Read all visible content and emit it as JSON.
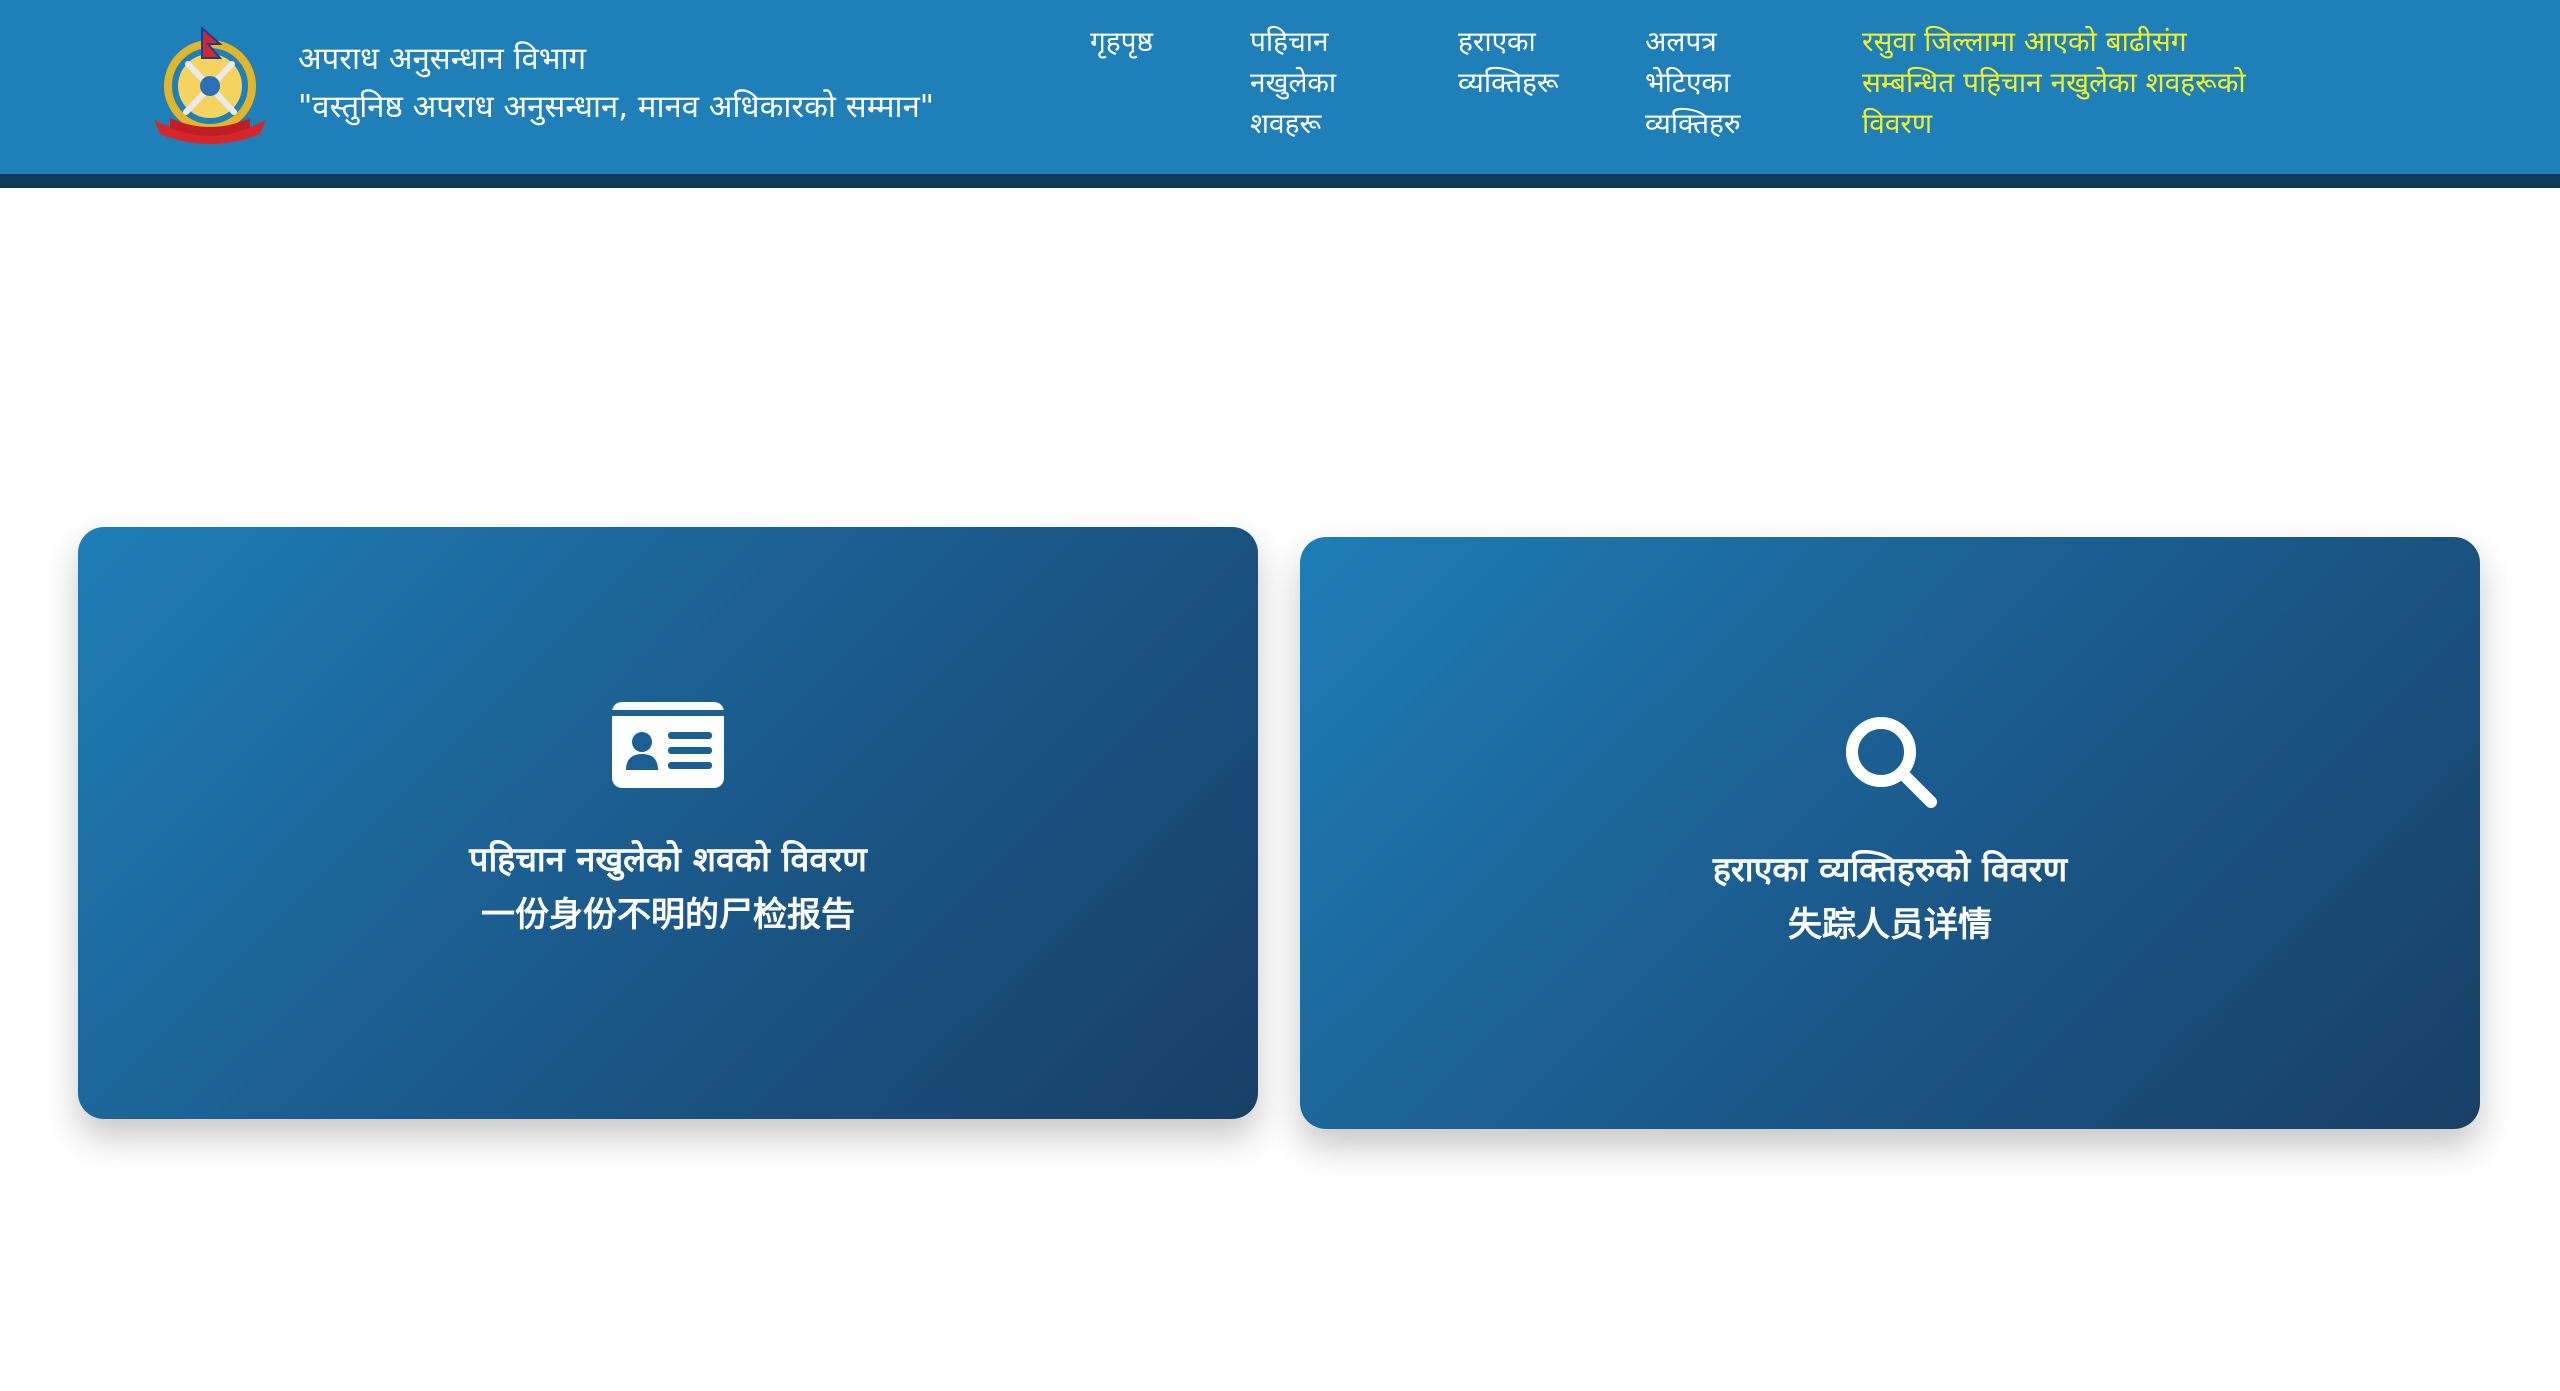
{
  "header": {
    "title": "अपराध अनुसन्धान विभाग",
    "slogan": "\"वस्तुनिष्ठ अपराध अनुसन्धान, मानव अधिकारको सम्मान\"",
    "logo_icon": "nepal-police-emblem-icon",
    "background_color": "#1f80b9",
    "bar_color": "#0b3b57"
  },
  "nav": {
    "home": [
      "गृहपृष्ठ"
    ],
    "unidentified_bodies": [
      "पहिचान",
      "नखुलेका",
      "शवहरू"
    ],
    "missing_persons": [
      "हराएका",
      "व्यक्तिहरू"
    ],
    "found_persons": [
      "अलपत्र",
      "भेटिएका",
      "व्यक्तिहरु"
    ],
    "rasuwa_flood": [
      "रसुवा जिल्लामा आएको बाढीसंग",
      "सम्बन्धित पहिचान नखुलेका शवहरूको",
      "विवरण"
    ],
    "highlight_color": "#f2ef2a"
  },
  "cards": [
    {
      "icon": "id-card-icon",
      "title": "पहिचान नखुलेको शवको विवरण",
      "subtitle": "一份身份不明的尸检报告"
    },
    {
      "icon": "search-icon",
      "title": "हराएका व्यक्तिहरुको विवरण",
      "subtitle": "失踪人员详情"
    }
  ]
}
